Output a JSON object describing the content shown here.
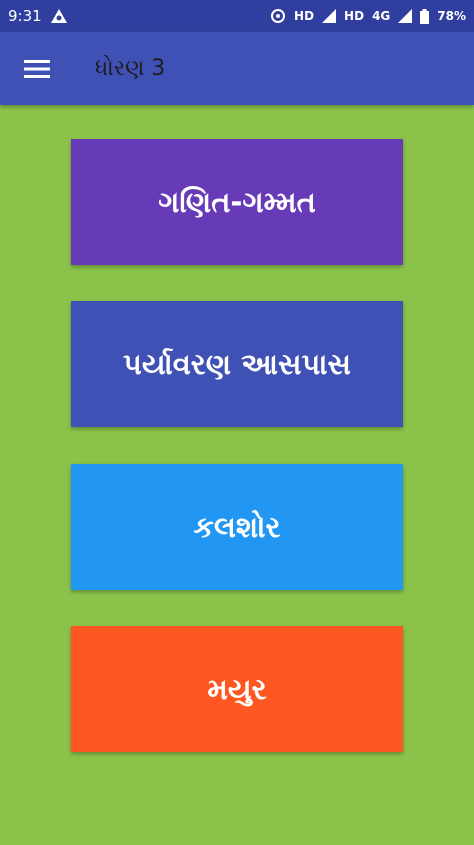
{
  "status_bar": {
    "time": "9:31",
    "network_1": "HD",
    "network_2": "HD",
    "network_3": "4G",
    "battery": "78%"
  },
  "app_bar": {
    "title": "ધોરણ 3"
  },
  "subjects": [
    {
      "label": "ગણિત-ગમ્મત",
      "color": "#673ab7"
    },
    {
      "label": "પર્યાવરણ આસપાસ",
      "color": "#3f51b5"
    },
    {
      "label": "કલશોર",
      "color": "#2196f3"
    },
    {
      "label": "મયુર",
      "color": "#ff5722"
    }
  ]
}
